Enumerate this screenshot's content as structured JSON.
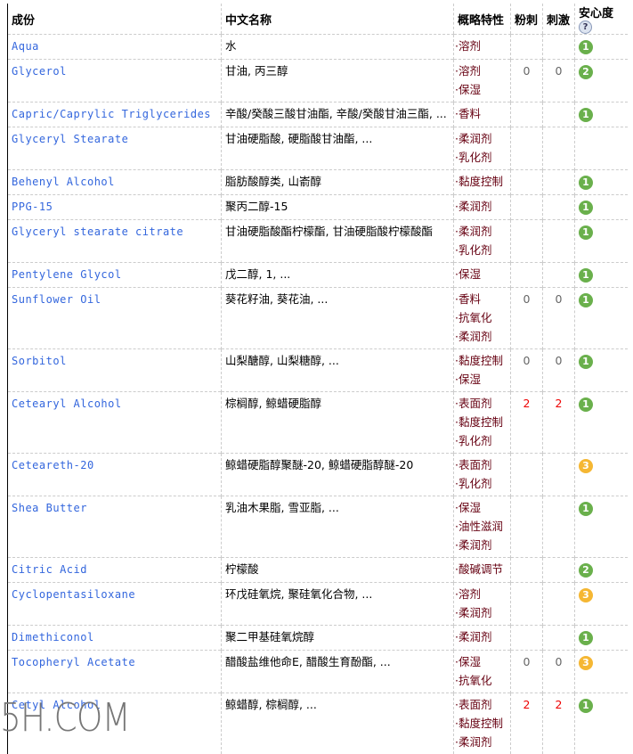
{
  "header": {
    "name": "成份",
    "cn": "中文名称",
    "prop": "概略特性",
    "acne": "粉刺",
    "irritant": "刺激",
    "safety": "安心度",
    "help": "?"
  },
  "colors": {
    "safe": "#6ab04c",
    "moderate": "#f5b733",
    "link": "#3366dd",
    "property": "#660011",
    "risk": "#ee0000"
  },
  "rows": [
    {
      "name": "Aqua",
      "cn": "水",
      "props": [
        "·溶剂"
      ],
      "acne": "",
      "irritant": "",
      "safety": "1"
    },
    {
      "name": "Glycerol",
      "cn": "甘油, 丙三醇",
      "props": [
        "·溶剂",
        "·保湿"
      ],
      "acne": "0",
      "irritant": "0",
      "safety": "2"
    },
    {
      "name": "Capric/Caprylic Triglycerides",
      "cn": "辛酸/癸酸三酸甘油酯, 辛酸/癸酸甘油三酯, ...",
      "props": [
        "·香料"
      ],
      "acne": "",
      "irritant": "",
      "safety": "1"
    },
    {
      "name": "Glyceryl Stearate",
      "cn": "甘油硬脂酸, 硬脂酸甘油酯, ...",
      "props": [
        "·柔润剂",
        "·乳化剂"
      ],
      "acne": "",
      "irritant": "",
      "safety": ""
    },
    {
      "name": "Behenyl Alcohol",
      "cn": "脂肪酸醇类, 山嵛醇",
      "props": [
        "·黏度控制"
      ],
      "acne": "",
      "irritant": "",
      "safety": "1"
    },
    {
      "name": "PPG-15",
      "cn": "聚丙二醇-15",
      "props": [
        "·柔润剂"
      ],
      "acne": "",
      "irritant": "",
      "safety": "1"
    },
    {
      "name": "Glyceryl stearate citrate",
      "cn": "甘油硬脂酸酯柠檬酯, 甘油硬脂酸柠檬酸酯",
      "props": [
        "·柔润剂",
        "·乳化剂"
      ],
      "acne": "",
      "irritant": "",
      "safety": "1"
    },
    {
      "name": "Pentylene Glycol",
      "cn": "戊二醇, 1, ...",
      "props": [
        "·保湿"
      ],
      "acne": "",
      "irritant": "",
      "safety": "1"
    },
    {
      "name": "Sunflower Oil",
      "cn": "葵花籽油, 葵花油, ...",
      "props": [
        "·香料",
        "·抗氧化",
        "·柔润剂"
      ],
      "acne": "0",
      "irritant": "0",
      "safety": "1"
    },
    {
      "name": "Sorbitol",
      "cn": "山梨醣醇, 山梨糖醇, ...",
      "props": [
        "·黏度控制",
        "·保湿"
      ],
      "acne": "0",
      "irritant": "0",
      "safety": "1"
    },
    {
      "name": "Cetearyl Alcohol",
      "cn": "棕榈醇, 鲸蜡硬脂醇",
      "props": [
        "·表面剂",
        "·黏度控制",
        "·乳化剂"
      ],
      "acne": "2",
      "irritant": "2",
      "safety": "1"
    },
    {
      "name": "Ceteareth-20",
      "cn": "鲸蜡硬脂醇聚醚-20, 鲸蜡硬脂醇醚-20",
      "props": [
        "·表面剂",
        "·乳化剂"
      ],
      "acne": "",
      "irritant": "",
      "safety": "3"
    },
    {
      "name": "Shea Butter",
      "cn": "乳油木果脂, 雪亚脂, ...",
      "props": [
        "·保湿",
        "·油性滋润",
        "·柔润剂"
      ],
      "acne": "",
      "irritant": "",
      "safety": "1"
    },
    {
      "name": "Citric Acid",
      "cn": "柠檬酸",
      "props": [
        "·酸碱调节"
      ],
      "acne": "",
      "irritant": "",
      "safety": "2"
    },
    {
      "name": "Cyclopentasiloxane",
      "cn": "环戊硅氧烷, 聚硅氧化合物, ...",
      "props": [
        "·溶剂",
        "·柔润剂"
      ],
      "acne": "",
      "irritant": "",
      "safety": "3"
    },
    {
      "name": "Dimethiconol",
      "cn": "聚二甲基硅氧烷醇",
      "props": [
        "·柔润剂"
      ],
      "acne": "",
      "irritant": "",
      "safety": "1"
    },
    {
      "name": "Tocopheryl Acetate",
      "cn": "醋酸盐维他命E, 醋酸生育酚酯, ...",
      "props": [
        "·保湿",
        "·抗氧化"
      ],
      "acne": "0",
      "irritant": "0",
      "safety": "3"
    },
    {
      "name": "Cetyl Alcohol",
      "cn": "鲸蜡醇, 棕榈醇, ...",
      "props": [
        "·表面剂",
        "·黏度控制",
        "·柔润剂"
      ],
      "acne": "2",
      "irritant": "2",
      "safety": "1"
    }
  ],
  "watermark": "5H.COM"
}
